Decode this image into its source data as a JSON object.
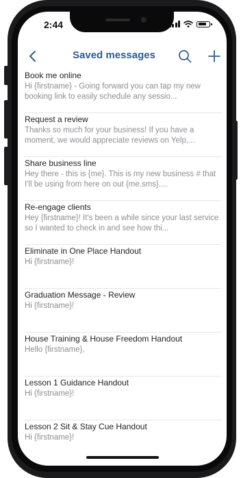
{
  "status_bar": {
    "time": "2:44"
  },
  "navbar": {
    "title": "Saved messages"
  },
  "messages": [
    {
      "title": "Book me online",
      "preview": "Hi {firstname} - Going forward you can tap my new booking link to easily schedule any sessio..."
    },
    {
      "title": "Request a review",
      "preview": "Thanks so much for your business! If you have a moment, we would appreciate reviews on Yelp,..."
    },
    {
      "title": "Share business line",
      "preview": "Hey there - this is {me}. This is my new business # that I'll be using from here on out {me.sms}...."
    },
    {
      "title": "Re-engage clients",
      "preview": "Hey {firstname}! It's been a while since your last service so I wanted to check in and see how thi..."
    },
    {
      "title": "Eliminate in One Place Handout",
      "preview": "Hi {firstname}!"
    },
    {
      "title": "Graduation Message - Review",
      "preview": "Hi {firstname}!"
    },
    {
      "title": "House Training & House Freedom Handout",
      "preview": "Hello {firstname},"
    },
    {
      "title": "Lesson 1 Guidance Handout",
      "preview": "Hi {firstname}!"
    },
    {
      "title": "Lesson 2 Sit & Stay Cue Handout",
      "preview": "Hi {firstname}!"
    }
  ],
  "colors": {
    "accent": "#2f5d8e",
    "preview_text": "#8e8e93",
    "title_text": "#222222",
    "divider": "#e6e6e9"
  },
  "icons": {
    "back": "chevron-left-icon",
    "search": "search-icon",
    "add": "plus-icon"
  }
}
